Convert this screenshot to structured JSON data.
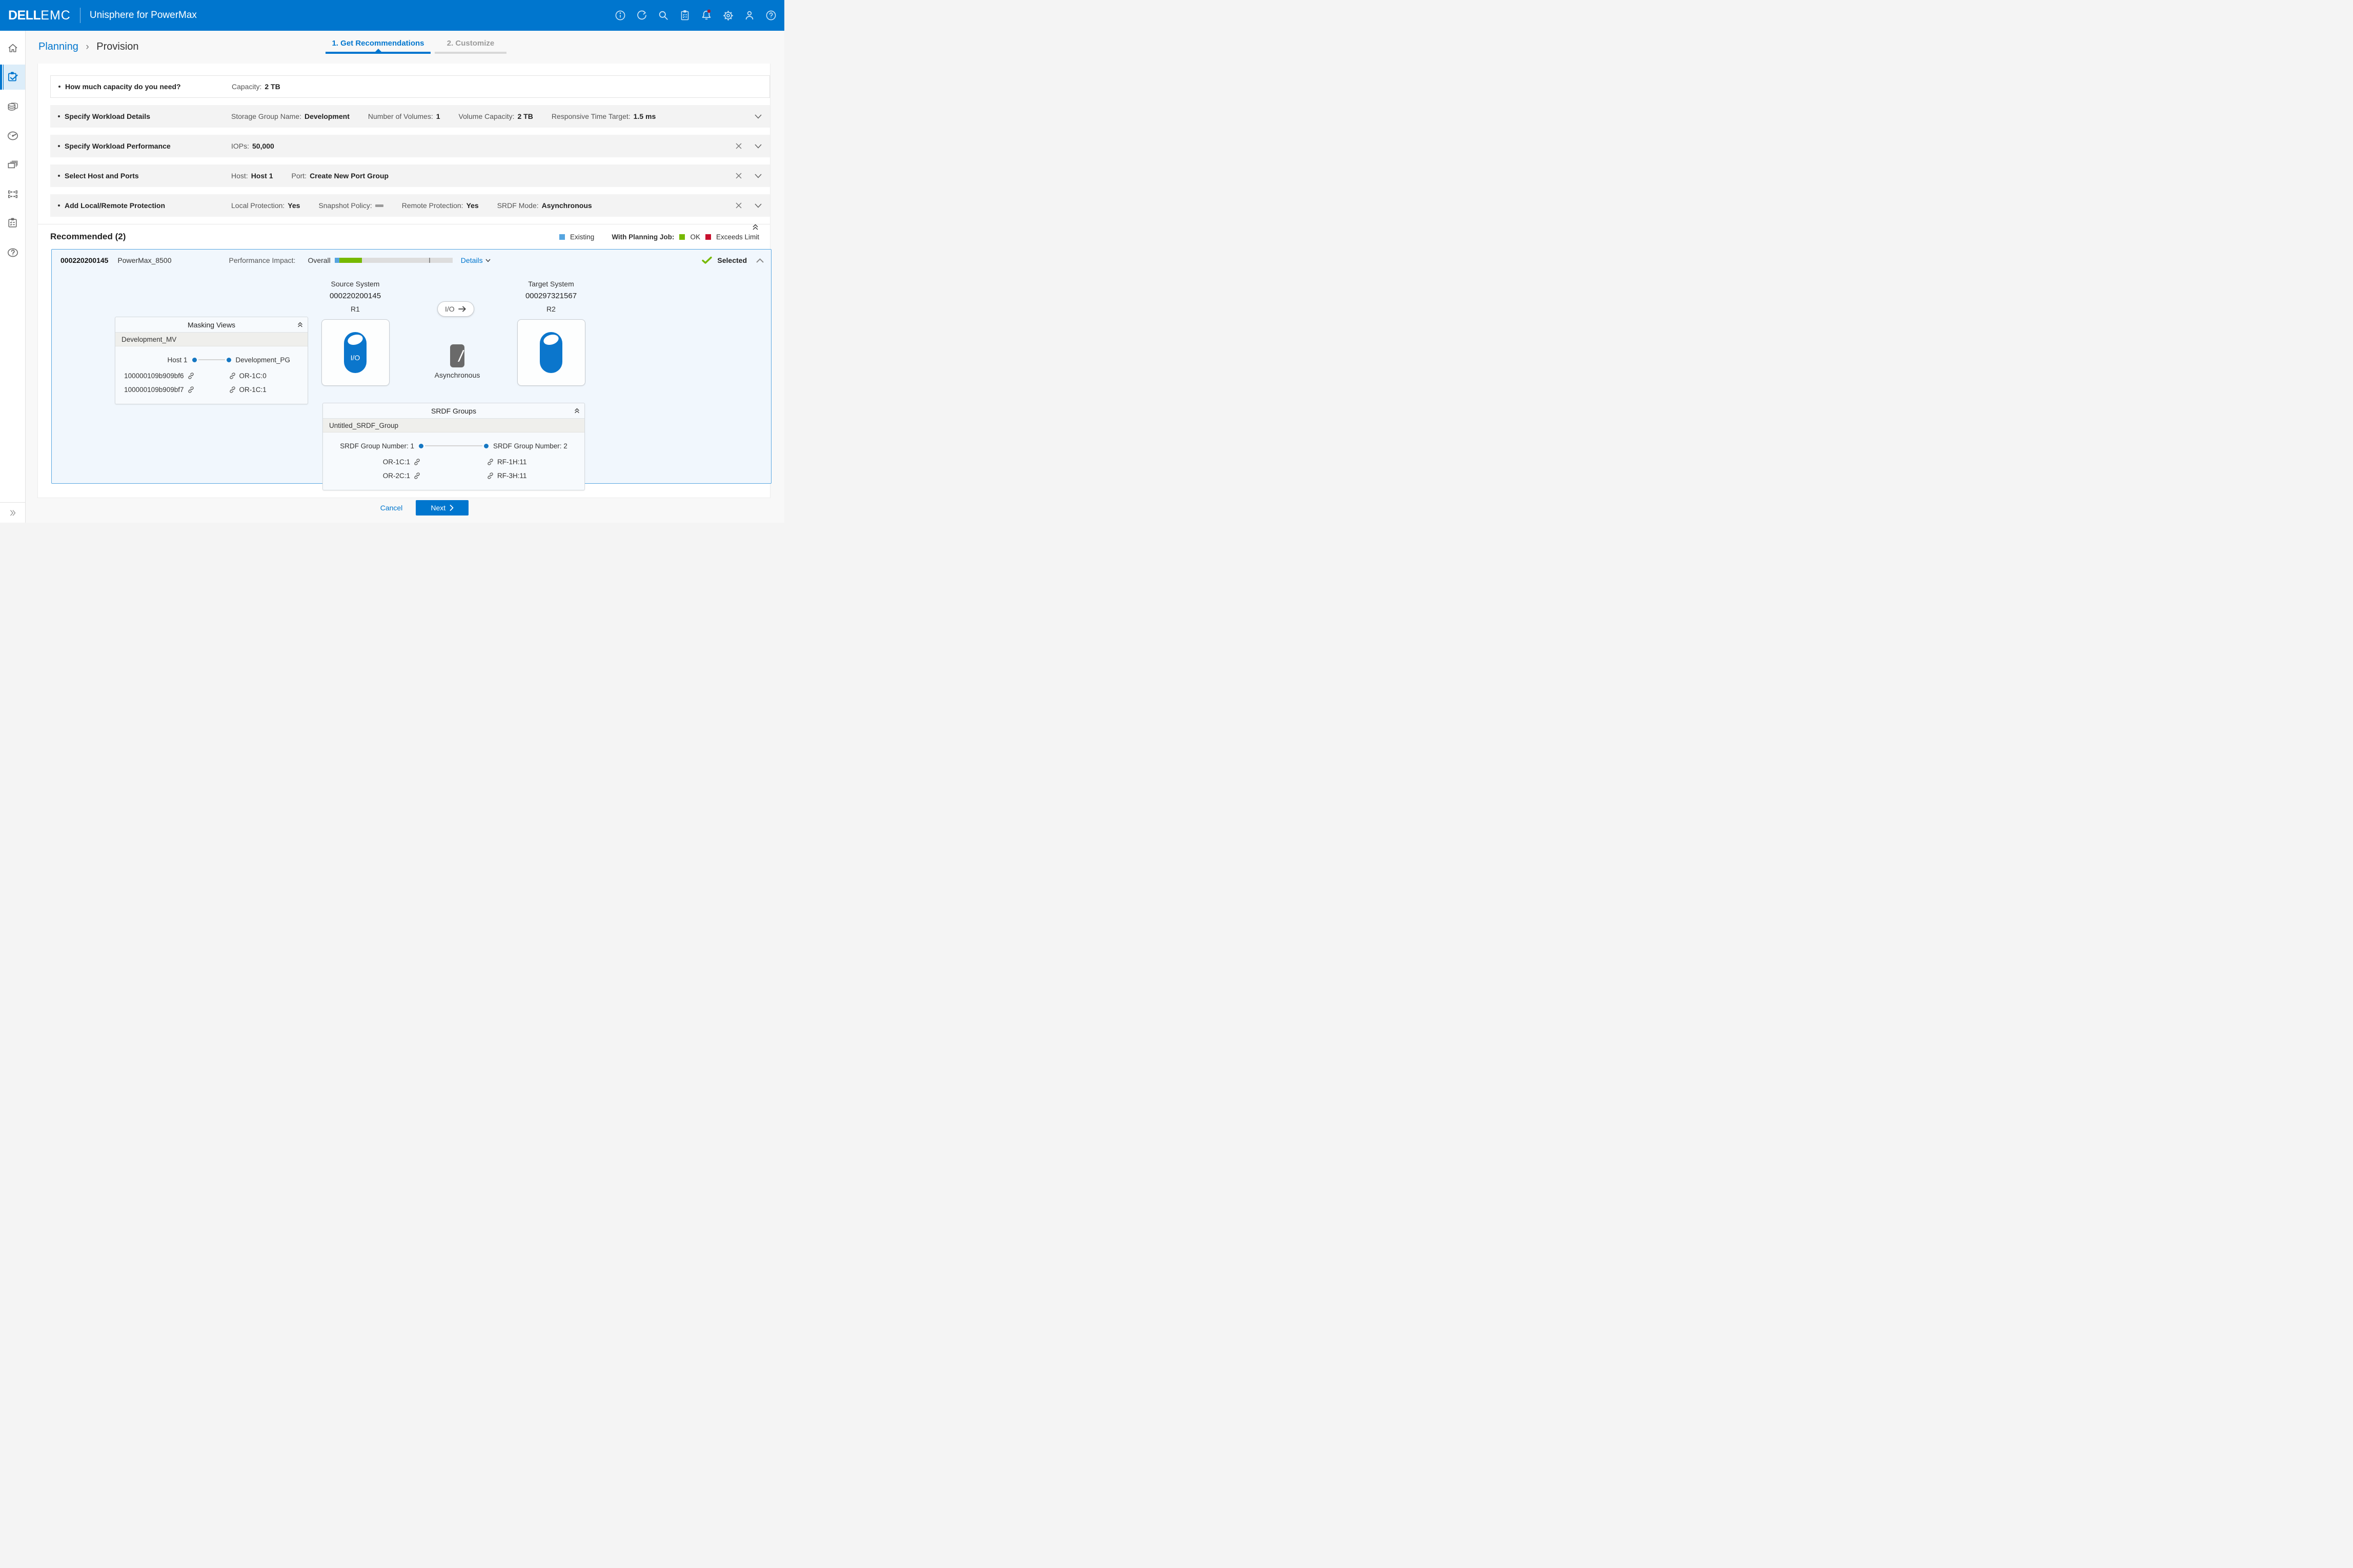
{
  "colors": {
    "accent": "#0076ce",
    "ok_green": "#76b900",
    "exceeds_red": "#c8102e",
    "existing_blue": "#56a5e0"
  },
  "header": {
    "brand_primary": "DELL",
    "brand_secondary": "EMC",
    "app_title": "Unisphere for PowerMax",
    "icons": [
      "info-icon",
      "refresh-icon",
      "search-icon",
      "tasks-icon",
      "alerts-icon",
      "settings-icon",
      "user-icon",
      "help-icon"
    ],
    "alert_badge": true
  },
  "sidebar": {
    "icons": [
      "home-icon",
      "planning-icon",
      "storage-icon",
      "performance-icon",
      "replication-icon",
      "hosts-icon",
      "jobs-icon",
      "support-icon",
      "expand-icon"
    ],
    "active": "planning-icon"
  },
  "breadcrumb": {
    "parent": "Planning",
    "separator": "›",
    "current": "Provision"
  },
  "steps": {
    "step1": "1. Get Recommendations",
    "step2": "2. Customize"
  },
  "accordion": {
    "rows": [
      {
        "title": "How much capacity do you need?",
        "fields": [
          {
            "label": "Capacity:",
            "value": "2 TB"
          }
        ]
      },
      {
        "title": "Specify Workload Details",
        "fields": [
          {
            "label": "Storage Group Name:",
            "value": "Development"
          },
          {
            "label": "Number of Volumes:",
            "value": "1"
          },
          {
            "label": "Volume Capacity:",
            "value": "2 TB"
          },
          {
            "label": "Responsive Time Target:",
            "value": "1.5 ms"
          }
        ]
      },
      {
        "title": "Specify Workload Performance",
        "fields": [
          {
            "label": "IOPs:",
            "value": "50,000"
          }
        ]
      },
      {
        "title": "Select Host and Ports",
        "fields": [
          {
            "label": "Host:",
            "value": "Host 1"
          },
          {
            "label": "Port:",
            "value": "Create New Port Group"
          }
        ]
      },
      {
        "title": "Add Local/Remote Protection",
        "fields": [
          {
            "label": "Local Protection:",
            "value": "Yes"
          },
          {
            "label": "Snapshot Policy:",
            "value": ""
          },
          {
            "label": "Remote Protection:",
            "value": "Yes"
          },
          {
            "label": "SRDF Mode:",
            "value": "Asynchronous"
          }
        ]
      }
    ]
  },
  "recommended": {
    "title": "Recommended (2)",
    "legend": {
      "existing": "Existing",
      "with_planning_job": "With Planning Job:",
      "ok": "OK",
      "exceeds": "Exceeds Limit"
    }
  },
  "card": {
    "system_id": "000220200145",
    "model": "PowerMax_8500",
    "performance_label": "Performance Impact:",
    "overall_label": "Overall",
    "details_label": "Details",
    "selected_label": "Selected",
    "impact_bar": {
      "existing_pct": 4,
      "planning_pct": 19,
      "limit_tick_pct": 80
    },
    "diagram": {
      "source": {
        "title": "Source System",
        "id": "000220200145",
        "role": "R1"
      },
      "target": {
        "title": "Target System",
        "id": "000297321567",
        "role": "R2"
      },
      "io_label": "I/O",
      "mode": "Asynchronous"
    },
    "masking_views": {
      "title": "Masking Views",
      "group_name": "Development_MV",
      "left_node": "Host 1",
      "right_node": "Development_PG",
      "links": [
        {
          "left": "100000109b909bf6",
          "right": "OR-1C:0"
        },
        {
          "left": "100000109b909bf7",
          "right": "OR-1C:1"
        }
      ]
    },
    "srdf_groups": {
      "title": "SRDF Groups",
      "group_name": "Untitled_SRDF_Group",
      "left_node": "SRDF Group Number: 1",
      "right_node": "SRDF Group Number: 2",
      "links": [
        {
          "left": "OR-1C:1",
          "right": "RF-1H:11"
        },
        {
          "left": "OR-2C:1",
          "right": "RF-3H:11"
        }
      ]
    }
  },
  "footer": {
    "cancel": "Cancel",
    "next": "Next"
  }
}
